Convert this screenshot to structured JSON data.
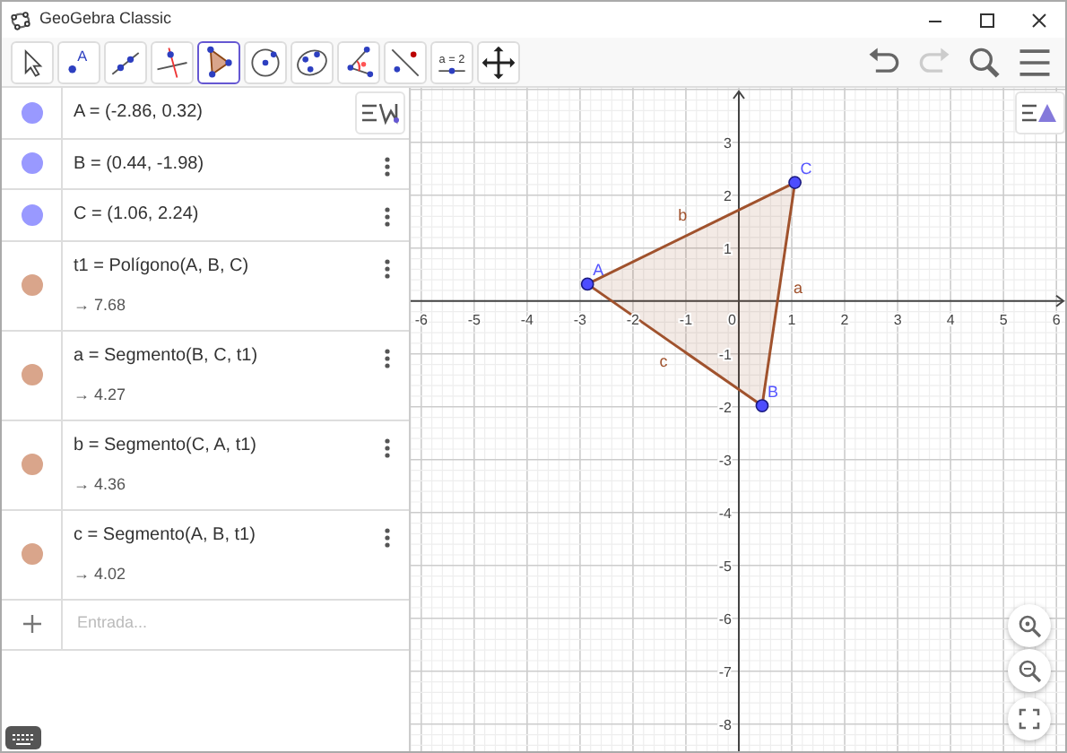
{
  "window": {
    "title": "GeoGebra Classic"
  },
  "toolbar": {
    "tools": [
      {
        "kind": "pointer",
        "selected": false
      },
      {
        "kind": "point",
        "label": "A",
        "selected": false
      },
      {
        "kind": "line",
        "selected": false
      },
      {
        "kind": "perpendicular",
        "selected": false
      },
      {
        "kind": "polygon",
        "selected": true
      },
      {
        "kind": "circle",
        "selected": false
      },
      {
        "kind": "conic",
        "selected": false
      },
      {
        "kind": "angle",
        "selected": false
      },
      {
        "kind": "reflect",
        "selected": false
      },
      {
        "kind": "slider",
        "label": "a = 2",
        "selected": false
      },
      {
        "kind": "move",
        "selected": false
      }
    ],
    "actions": [
      {
        "kind": "undo",
        "disabled": false
      },
      {
        "kind": "redo",
        "disabled": true
      },
      {
        "kind": "search",
        "disabled": false
      },
      {
        "kind": "menu",
        "disabled": false
      }
    ]
  },
  "algebra": {
    "rows": [
      {
        "definition": "A = (-2.86, 0.32)",
        "color": "#9999ff",
        "visible": true,
        "menu": false
      },
      {
        "definition": "B = (0.44, -1.98)",
        "color": "#9999ff",
        "visible": true,
        "menu": true
      },
      {
        "definition": "C = (1.06, 2.24)",
        "color": "#9999ff",
        "visible": true,
        "menu": true
      },
      {
        "definition": "t1 = Polígono(A, B, C)",
        "value": "→ 7.68",
        "color": "#d9a58b",
        "visible": true,
        "menu": true
      },
      {
        "definition": "a = Segmento(B, C, t1)",
        "value": "→ 4.27",
        "color": "#d9a58b",
        "visible": true,
        "menu": true
      },
      {
        "definition": "b = Segmento(C, A, t1)",
        "value": "→ 4.36",
        "color": "#d9a58b",
        "visible": true,
        "menu": true
      },
      {
        "definition": "c = Segmento(A, B, t1)",
        "value": "→ 4.02",
        "color": "#d9a58b",
        "visible": true,
        "menu": true
      }
    ],
    "input": {
      "placeholder": "Entrada..."
    }
  },
  "graphics": {
    "chart_data": {
      "type": "scatter",
      "x": [
        -2.86,
        0.44,
        1.06
      ],
      "series": [
        {
          "color": "#4d4dff",
          "values": [
            0.32,
            -1.98,
            2.24
          ]
        }
      ],
      "grid": true,
      "xlim": [
        -6.2,
        6.2
      ],
      "ylim": [
        -8.58,
        4.03
      ],
      "xticks": [
        -6,
        -5,
        -4,
        -3,
        -2,
        -1,
        0,
        1,
        2,
        3,
        4,
        5,
        6
      ],
      "yticks": [
        -8,
        -7,
        -6,
        -5,
        -4,
        -3,
        -2,
        -1,
        1,
        2,
        3
      ],
      "annotations": [
        "A",
        "B",
        "C",
        "a",
        "b",
        "c"
      ]
    }
  }
}
